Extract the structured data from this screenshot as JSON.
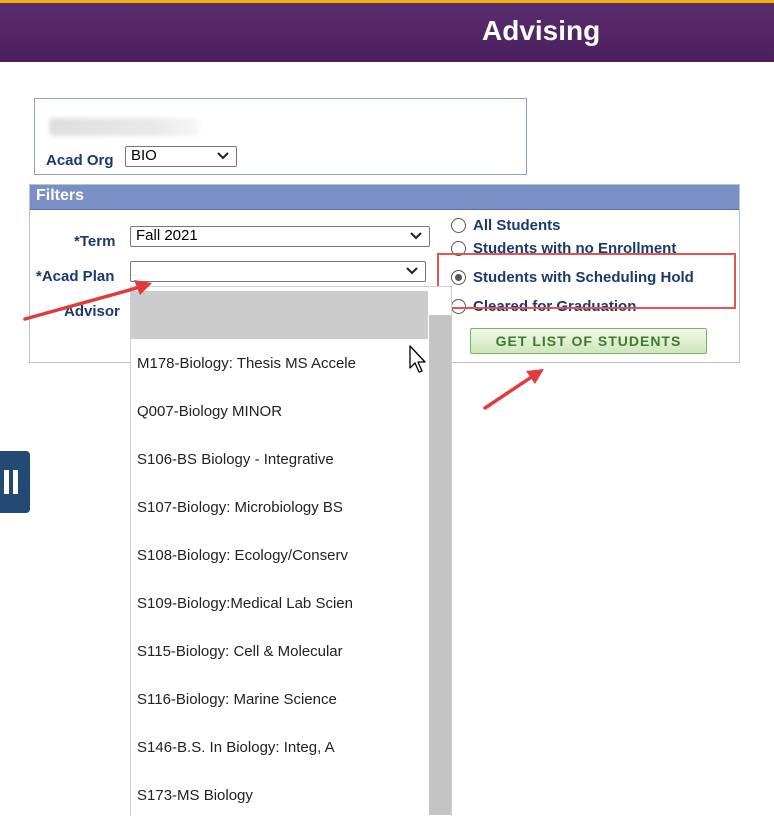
{
  "header": {
    "title": "Advising"
  },
  "org": {
    "acad_org_label": "Acad Org",
    "acad_org_value": "BIO"
  },
  "filters": {
    "title": "Filters",
    "term_label": "*Term",
    "term_value": "Fall 2021",
    "acad_plan_label": "*Acad Plan",
    "acad_plan_value": "",
    "advisor_label": "Advisor"
  },
  "radios": [
    {
      "label": "All Students",
      "selected": false
    },
    {
      "label": "Students with no Enrollment",
      "selected": false
    },
    {
      "label": "Students with Scheduling Hold",
      "selected": true
    },
    {
      "label": "Cleared for Graduation",
      "selected": false
    }
  ],
  "get_button": {
    "label": "GET LIST OF STUDENTS"
  },
  "plan_options": [
    "",
    "M178-Biology: Thesis MS Accele",
    "Q007-Biology MINOR",
    "S106-BS Biology - Integrative",
    "S107-Biology: Microbiology BS",
    "S108-Biology: Ecology/Conserv",
    "S109-Biology:Medical Lab Scien",
    "S115-Biology: Cell & Molecular",
    "S116-Biology: Marine Science",
    "S146-B.S. In Biology: Integ, A",
    "S173-MS Biology"
  ],
  "colors": {
    "header": "#5b2c6f",
    "header_accent": "#f0b400",
    "filters_bar": "#7a8fc6",
    "label": "#1b3a6b",
    "highlight": "#e25555",
    "button_text": "#3f7a2d"
  },
  "icons": [
    "chevron-down-icon",
    "pause-icon",
    "cursor-icon",
    "arrow-annotation"
  ]
}
